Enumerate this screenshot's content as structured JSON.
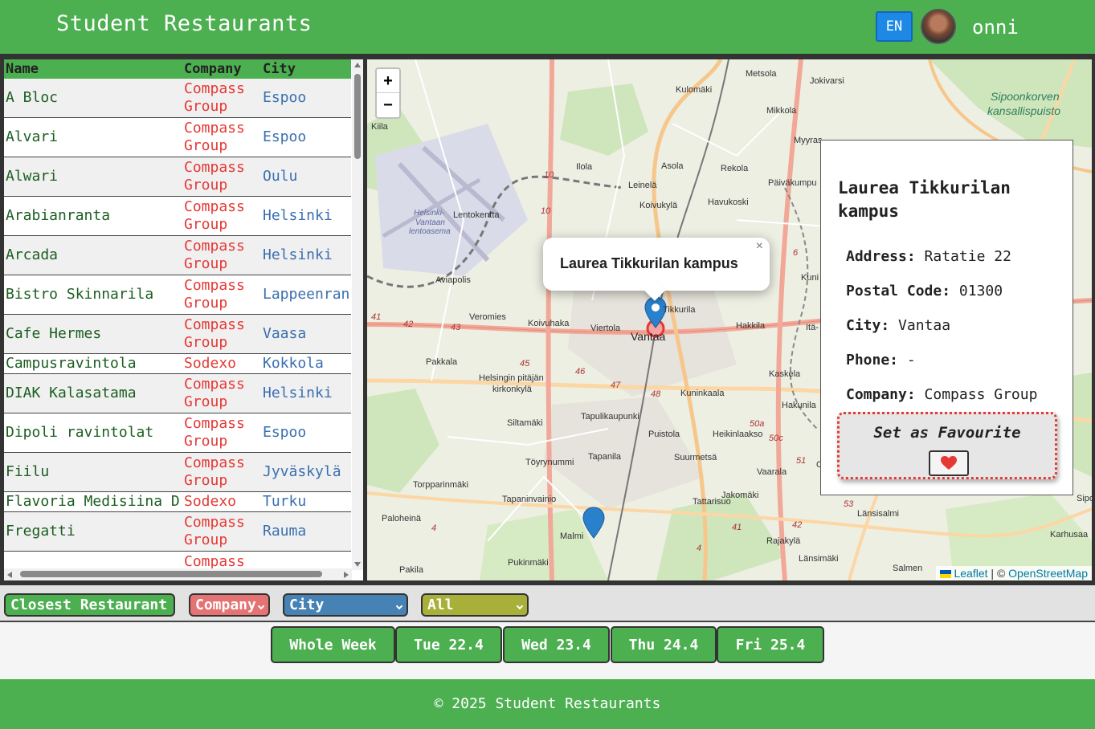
{
  "header": {
    "title": "Student Restaurants",
    "language": "EN",
    "username": "onni"
  },
  "table": {
    "columns": [
      "Name",
      "Company",
      "City"
    ],
    "rows": [
      {
        "name": "A Bloc",
        "company": "Compass\nGroup",
        "city": "Espoo"
      },
      {
        "name": "Alvari",
        "company": "Compass\nGroup",
        "city": "Espoo"
      },
      {
        "name": "Alwari",
        "company": "Compass\nGroup",
        "city": "Oulu"
      },
      {
        "name": "Arabianranta",
        "company": "Compass\nGroup",
        "city": "Helsinki"
      },
      {
        "name": "Arcada",
        "company": "Compass\nGroup",
        "city": "Helsinki"
      },
      {
        "name": "Bistro Skinnarila",
        "company": "Compass\nGroup",
        "city": "Lappeenran"
      },
      {
        "name": "Cafe Hermes",
        "company": "Compass\nGroup",
        "city": "Vaasa"
      },
      {
        "name": "Campusravintola",
        "company": "Sodexo",
        "city": "Kokkola"
      },
      {
        "name": "DIAK Kalasatama",
        "company": "Compass\nGroup",
        "city": "Helsinki"
      },
      {
        "name": "Dipoli ravintolat",
        "company": "Compass\nGroup",
        "city": "Espoo"
      },
      {
        "name": "Fiilu",
        "company": "Compass\nGroup",
        "city": "Jyväskylä"
      },
      {
        "name": "Flavoria Medisiina D",
        "company": "Sodexo",
        "city": "Turku"
      },
      {
        "name": "Fregatti",
        "company": "Compass\nGroup",
        "city": "Rauma"
      },
      {
        "name": "",
        "company": "Compass",
        "city": ""
      }
    ]
  },
  "map": {
    "zoom_in": "+",
    "zoom_out": "−",
    "popup": {
      "text": "Laurea Tikkurilan kampus",
      "close": "×"
    },
    "attribution": {
      "leaflet": "Leaflet",
      "separator": " | © ",
      "osm": "OpenStreetMap"
    },
    "labels": {
      "metsola": "Metsola",
      "jokivarsi": "Jokivarsi",
      "kulomaki": "Kulomäki",
      "mikkola": "Mikkola",
      "myyras": "Myyras",
      "sipoonkorpi1": "Sipoonkorven",
      "sipoonkorpi2": "kansallispuisto",
      "kiila": "Kiila",
      "ilola": "Ilola",
      "asola": "Asola",
      "rekola": "Rekola",
      "paivakumpu": "Päiväkumpu",
      "leinela": "Leinelä",
      "koivukyla": "Koivukylä",
      "havukoski": "Havukoski",
      "lentokentta": "Lentokentta",
      "airport1": "Helsinki-",
      "airport2": "Vantaan",
      "airport3": "lentoasema",
      "aviapolis": "Aviapolis",
      "kuni": "Kuni",
      "tikkurila": "Tikkurila",
      "veromies": "Veromies",
      "koivuhaka": "Koivuhaka",
      "viertola": "Viertola",
      "vantaa": "Vantaa",
      "hakkila": "Hakkila",
      "ita": "Itä-",
      "pakkala": "Pakkala",
      "helsinginpitajan": "Helsingin pitäjän",
      "kirkonkyla": "kirkonkylä",
      "kaskela": "Kaskela",
      "kuninkaala": "Kuninkaala",
      "tapulikaupunki": "Tapulikaupunki",
      "hakunila": "Hakunila",
      "siltamaki": "Siltamäki",
      "puistola": "Puistola",
      "heikinlaakso": "Heikinlaakso",
      "toyrynummi": "Töyrynummi",
      "tapanila": "Tapanila",
      "suurmetsa": "Suurmetsä",
      "vaarala": "Vaarala",
      "torpparinmaki": "Torpparinmäki",
      "tapaninvainio": "Tapaninvainio",
      "tattarisuo": "Tattarisuo",
      "jakomaki": "Jakomäki",
      "lansisalmi": "Länsisalmi",
      "paloheina": "Paloheinä",
      "malmi": "Malmi",
      "rajakyla": "Rajakylä",
      "karhusaari": "Karhusaa",
      "pukinmaki": "Pukinmäki",
      "lansimaki": "Länsimäki",
      "pakila": "Pakila",
      "salmen": "Salmen",
      "sipo": "Sipo",
      "oj": "Oj",
      "r41": "41",
      "r42": "42",
      "r43": "43",
      "r45": "45",
      "r46": "46",
      "r47": "47",
      "r48": "48",
      "r10a": "10",
      "r10b": "10",
      "r51": "51",
      "r50": "50a",
      "r4": "4",
      "r53": "53",
      "r42b": "42",
      "r41b": "41",
      "r6": "6",
      "r50b": "50c",
      "r4b": "4"
    }
  },
  "info_card": {
    "title": "Laurea Tikkurilan kampus",
    "address_label": "Address:",
    "address": "Ratatie 22",
    "postal_label": "Postal Code:",
    "postal": "01300",
    "city_label": "City:",
    "city": "Vantaa",
    "phone_label": "Phone:",
    "phone": "-",
    "company_label": "Company:",
    "company": "Compass Group",
    "favourite_label": "Set as Favourite",
    "heart": "❤️"
  },
  "filters": {
    "closest": "Closest Restaurant",
    "company": "Company",
    "city": "City",
    "all": "All"
  },
  "days": [
    "Whole Week",
    "Tue 22.4",
    "Wed 23.4",
    "Thu 24.4",
    "Fri 25.4"
  ],
  "footer": "© 2025 Student Restaurants",
  "colors": {
    "primary": "#4caf50",
    "company_filter": "#e57373",
    "city_filter": "#4682b4",
    "all_filter": "#a8b03a",
    "marker": "#2a81cb",
    "highlight": "#e53935"
  }
}
